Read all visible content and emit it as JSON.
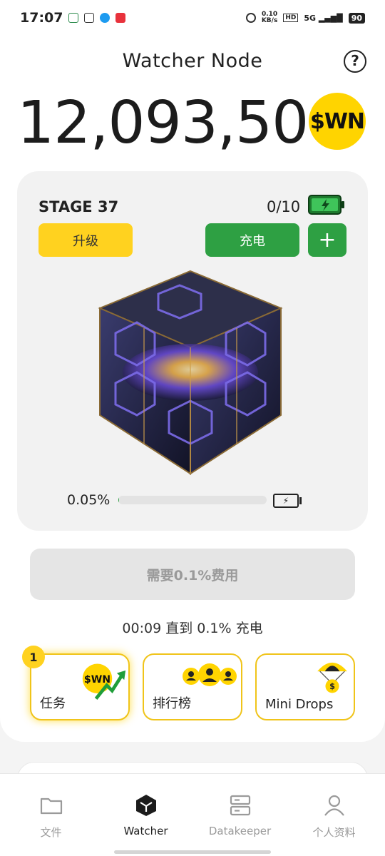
{
  "status_bar": {
    "time": "17:07",
    "net_speed": "0.10",
    "net_unit": "KB/s",
    "hd": "HD",
    "signal": "5G",
    "battery": "90"
  },
  "header": {
    "title": "Watcher Node",
    "help_icon": "?"
  },
  "balance": {
    "amount": "12,093,500",
    "coin_label": "$WN"
  },
  "stage_card": {
    "stage": "STAGE 37",
    "charge_count": "0/10",
    "upgrade_label": "升级",
    "charge_label": "充电",
    "plus_label": "+",
    "progress_text": "0.05%",
    "progress_fraction": 0.0005
  },
  "fee_button": {
    "label": "需要0.1%费用"
  },
  "timer": {
    "text": "00:09  直到  0.1% 充电"
  },
  "tasks": [
    {
      "label": "任务",
      "badge": "1",
      "coin": "$WN"
    },
    {
      "label": "排行榜"
    },
    {
      "label": "Mini Drops"
    }
  ],
  "nav": [
    {
      "label": "文件",
      "icon": "folder-icon"
    },
    {
      "label": "Watcher",
      "icon": "cube-icon",
      "active": true
    },
    {
      "label": "Datakeeper",
      "icon": "server-icon"
    },
    {
      "label": "个人资料",
      "icon": "person-icon"
    }
  ],
  "colors": {
    "accent_yellow": "#ffd21f",
    "accent_green": "#2ea043",
    "coin_yellow": "#ffd400"
  }
}
